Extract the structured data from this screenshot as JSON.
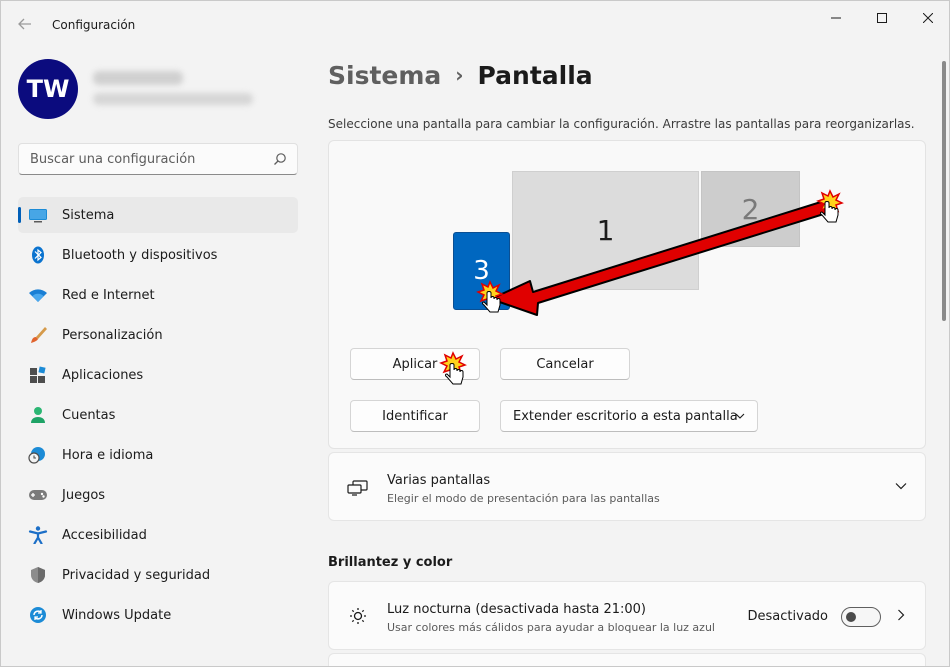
{
  "window": {
    "title": "Configuración"
  },
  "profile": {
    "initials": "TW"
  },
  "search": {
    "placeholder": "Buscar una configuración"
  },
  "sidebar": {
    "items": [
      {
        "label": "Sistema",
        "icon": "monitor-icon",
        "active": true
      },
      {
        "label": "Bluetooth y dispositivos",
        "icon": "bluetooth-icon"
      },
      {
        "label": "Red e Internet",
        "icon": "wifi-icon"
      },
      {
        "label": "Personalización",
        "icon": "brush-icon"
      },
      {
        "label": "Aplicaciones",
        "icon": "apps-icon"
      },
      {
        "label": "Cuentas",
        "icon": "person-icon"
      },
      {
        "label": "Hora e idioma",
        "icon": "globe-clock-icon"
      },
      {
        "label": "Juegos",
        "icon": "gamepad-icon"
      },
      {
        "label": "Accesibilidad",
        "icon": "accessibility-icon"
      },
      {
        "label": "Privacidad y seguridad",
        "icon": "shield-icon"
      },
      {
        "label": "Windows Update",
        "icon": "update-icon"
      }
    ]
  },
  "main": {
    "breadcrumb": {
      "parent": "Sistema",
      "current": "Pantalla"
    },
    "description": "Seleccione una pantalla para cambiar la configuración. Arrastre las pantallas para reorganizarlas.",
    "monitors": [
      {
        "label": "1"
      },
      {
        "label": "2"
      },
      {
        "label": "3"
      }
    ],
    "buttons": {
      "apply": "Aplicar",
      "cancel": "Cancelar",
      "identify": "Identificar"
    },
    "dropdown": {
      "selected": "Extender escritorio a esta pantalla"
    },
    "varias": {
      "title": "Varias pantallas",
      "subtitle": "Elegir el modo de presentación para las pantallas"
    },
    "section_brillo": "Brillantez y color",
    "luz": {
      "title": "Luz nocturna (desactivada hasta 21:00)",
      "subtitle": "Usar colores más cálidos para ayudar a bloquear la luz azul",
      "state": "Desactivado"
    }
  },
  "colors": {
    "accent": "#005fb8",
    "selected_monitor": "#0067c0",
    "arrow": "#e00000"
  }
}
